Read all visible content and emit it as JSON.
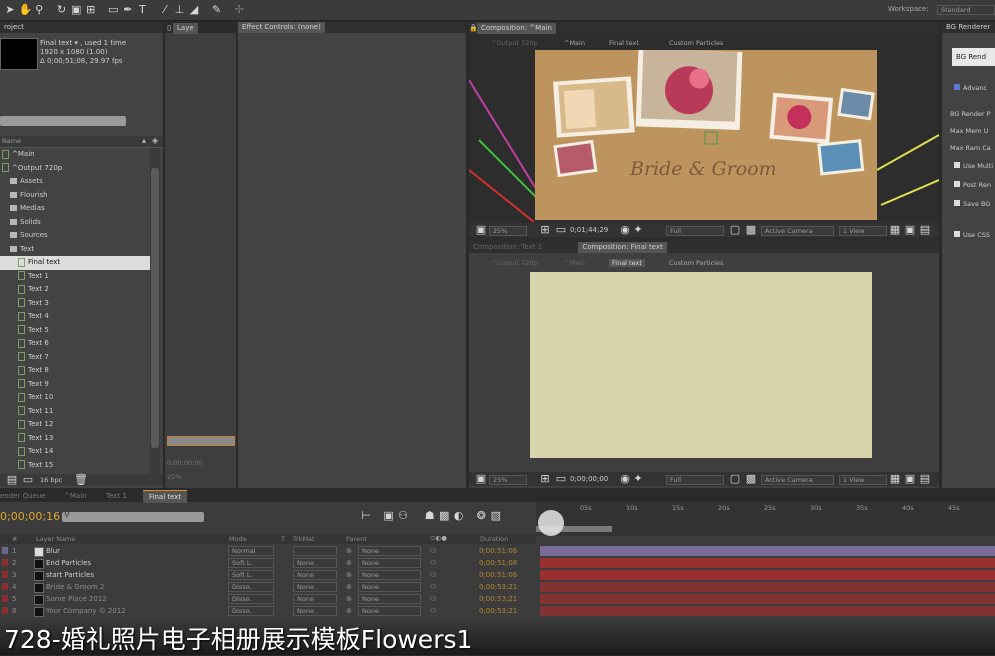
{
  "workspace": {
    "label": "Workspace:",
    "value": "Standard"
  },
  "project": {
    "tab": "roject",
    "item_title": "Final text ▾ , used 1 time",
    "item_res": "1920 x 1080 (1.00)",
    "item_dur": "Δ 0;00;51;08, 29.97 fps",
    "col_name": "Name",
    "items": [
      {
        "label": "^Main",
        "kind": "comp",
        "indent": 0
      },
      {
        "label": "^Output 720p",
        "kind": "comp",
        "indent": 0
      },
      {
        "label": "Assets",
        "kind": "folder",
        "indent": 1
      },
      {
        "label": "Flourish",
        "kind": "folder",
        "indent": 1
      },
      {
        "label": "Medias",
        "kind": "folder",
        "indent": 1
      },
      {
        "label": "Solids",
        "kind": "folder",
        "indent": 1
      },
      {
        "label": "Sources",
        "kind": "folder",
        "indent": 1
      },
      {
        "label": "Text",
        "kind": "folder",
        "indent": 1
      },
      {
        "label": "Final text",
        "kind": "comp",
        "indent": 2,
        "selected": true
      },
      {
        "label": "Text 1",
        "kind": "comp",
        "indent": 2
      },
      {
        "label": "Text 2",
        "kind": "comp",
        "indent": 2
      },
      {
        "label": "Text 3",
        "kind": "comp",
        "indent": 2
      },
      {
        "label": "Text 4",
        "kind": "comp",
        "indent": 2
      },
      {
        "label": "Text 5",
        "kind": "comp",
        "indent": 2
      },
      {
        "label": "Text 6",
        "kind": "comp",
        "indent": 2
      },
      {
        "label": "Text 7",
        "kind": "comp",
        "indent": 2
      },
      {
        "label": "Text 8",
        "kind": "comp",
        "indent": 2
      },
      {
        "label": "Text 9",
        "kind": "comp",
        "indent": 2
      },
      {
        "label": "Text 10",
        "kind": "comp",
        "indent": 2
      },
      {
        "label": "Text 11",
        "kind": "comp",
        "indent": 2
      },
      {
        "label": "Text 12",
        "kind": "comp",
        "indent": 2
      },
      {
        "label": "Text 13",
        "kind": "comp",
        "indent": 2
      },
      {
        "label": "Text 14",
        "kind": "comp",
        "indent": 2
      },
      {
        "label": "Text 15",
        "kind": "comp",
        "indent": 2
      }
    ],
    "bpc": "16 bpc"
  },
  "layer_panel": {
    "tab": "Laye",
    "timecode": "0;00;00;00",
    "zoom": "25%"
  },
  "effect_controls": {
    "tab": "Effect Controls: (none)"
  },
  "comp_main": {
    "tab": "Composition: ^Main",
    "crumbs": [
      "^Output 720p",
      "^Main",
      "Final text",
      "Custom Particles"
    ],
    "title_text": "Bride & Groom",
    "zoom": "25%",
    "time": "0;01;44;29",
    "res": "Full",
    "camera": "Active Camera",
    "view": "1 View"
  },
  "comp_final": {
    "tab_inactive": "Composition: Text 1",
    "tab": "Composition: Final text",
    "crumbs": [
      "^Output 720p",
      "^Main",
      "Final text",
      "Custom Particles"
    ],
    "canvas_color": "#d8d4ab",
    "zoom": "25%",
    "time": "0;00;00;00",
    "res": "Full",
    "camera": "Active Camera",
    "view": "1 View"
  },
  "bg_render": {
    "tab": "BG Renderer",
    "button": "BG Rend",
    "advanced": "Advanc",
    "labels": [
      "BG Render P",
      "Max Mem U",
      "Max Ram Ca"
    ],
    "checks": [
      "Use Multi",
      "Post Ren",
      "Save BG",
      "Use CSS"
    ]
  },
  "timeline": {
    "tabs": [
      "ender Queue",
      "^Main",
      "Text 1",
      "Final text"
    ],
    "timecode": "0;00;00;16",
    "ruler": [
      "05s",
      "10s",
      "15s",
      "20s",
      "25s",
      "30s",
      "35s",
      "40s",
      "45s"
    ],
    "cols": {
      "num": "#",
      "name": "Layer Name",
      "mode": "Mode",
      "t": "T",
      "trkmat": "TrkMat",
      "parent": "Parent",
      "duration": "Duration"
    },
    "layers": [
      {
        "num": "1",
        "name": "Blur",
        "mode": "Normal",
        "trk": "",
        "parent": "None",
        "dur": "0;00;51;08",
        "color": "#7c6f9e"
      },
      {
        "num": "2",
        "name": "End Particles",
        "mode": "Soft L.",
        "trk": "None",
        "parent": "None",
        "dur": "0;00;51;08",
        "color": "#9e2f2f"
      },
      {
        "num": "3",
        "name": "start Particles",
        "mode": "Soft L.",
        "trk": "None",
        "parent": "None",
        "dur": "0;00;51;08",
        "color": "#9e2f2f"
      },
      {
        "num": "4",
        "name": "Bride & Groom 2",
        "mode": "Disso.",
        "trk": "None",
        "parent": "None",
        "dur": "0;00;53;21",
        "color": "#9e2f2f"
      },
      {
        "num": "5",
        "name": "Some Place 2012",
        "mode": "Disso.",
        "trk": "None",
        "parent": "None",
        "dur": "0;00;53;21",
        "color": "#9e2f2f"
      },
      {
        "num": "8",
        "name": "Your Company © 2012",
        "mode": "Disso.",
        "trk": "None",
        "parent": "None",
        "dur": "0;00;53;21",
        "color": "#9e2f2f"
      }
    ]
  },
  "caption": "728-婚礼照片电子相册展示模板Flowers1"
}
